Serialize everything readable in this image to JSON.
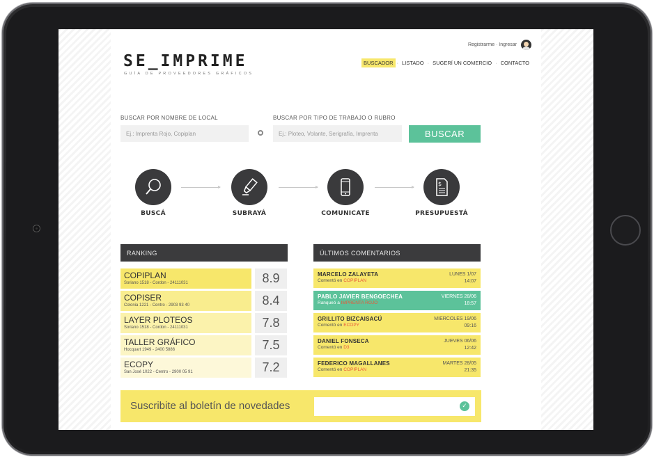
{
  "header": {
    "user_links": "Registrarme · Ingresar",
    "brand": "SE_IMPRIME",
    "tagline": "GUÍA DE PROVEEDORES GRÁFICOS",
    "nav": [
      {
        "label": "BUSCADOR",
        "active": true
      },
      {
        "label": "LISTADO",
        "active": false
      },
      {
        "label": "SUGERÍ UN COMERCIO",
        "active": false
      },
      {
        "label": "CONTACTO",
        "active": false
      }
    ],
    "nav_separator": "·"
  },
  "search": {
    "by_name_label": "BUSCAR POR NOMBRE DE LOCAL",
    "by_name_placeholder": "Ej.: Imprenta Rojo, Copiplan",
    "by_type_label": "BUSCAR POR TIPO DE TRABAJO O RUBRO",
    "by_type_placeholder": "Ej.: Ploteo, Volante, Serigrafía, Imprenta",
    "button_label": "BUSCAR"
  },
  "steps": [
    {
      "label": "BUSCÁ",
      "icon": "magnifier-icon"
    },
    {
      "label": "SUBRAYÁ",
      "icon": "highlighter-icon"
    },
    {
      "label": "COMUNICATE",
      "icon": "phone-icon"
    },
    {
      "label": "PRESUPUESTÁ",
      "icon": "invoice-icon"
    }
  ],
  "ranking": {
    "title": "RANKING",
    "items": [
      {
        "name": "COPIPLAN",
        "address": "Soriano 1518 - Cordon - 24111031",
        "score": "8.9",
        "color": "#f7e76b"
      },
      {
        "name": "COPISER",
        "address": "Colonia 1221 - Centro - 2903 93 40",
        "score": "8.4",
        "color": "#f9ed8e"
      },
      {
        "name": "LAYER PLOTEOS",
        "address": "Soriano 1518 - Cordon - 24111031",
        "score": "7.8",
        "color": "#fbf2ab"
      },
      {
        "name": "TALLER GRÁFICO",
        "address": "Hocquart 1949 - 2400 5886",
        "score": "7.5",
        "color": "#fcf5c4"
      },
      {
        "name": "ECOPY",
        "address": "San José 1022 - Centro - 2900 05 91",
        "score": "7.2",
        "color": "#fdf8d9"
      }
    ]
  },
  "comments": {
    "title": "ÚLTIMOS COMENTARIOS",
    "items": [
      {
        "author": "MARCELO ZALAYETA",
        "action": "Comentó en",
        "shop": "COPIPLAN",
        "day": "LUNES 1/07",
        "time": "14:07",
        "highlight": false
      },
      {
        "author": "PABLO JAVIER BENGOECHEA",
        "action": "Ranqueó a",
        "shop": "IMPRENTA ROJO",
        "day": "VIERNES 28/06",
        "time": "18:57",
        "highlight": true
      },
      {
        "author": "GRILLITO BIZCAISACÚ",
        "action": "Comentó en",
        "shop": "ECOPY",
        "day": "MIERCOLES 19/06",
        "time": "09:16",
        "highlight": false
      },
      {
        "author": "DANIEL FONSECA",
        "action": "Comentó en",
        "shop": "D3",
        "day": "JUEVES 06/06",
        "time": "12:42",
        "highlight": false
      },
      {
        "author": "FEDERICO MAGALLANES",
        "action": "Comentó en",
        "shop": "COPIPLAN",
        "day": "MARTES 28/05",
        "time": "21:35",
        "highlight": false
      }
    ]
  },
  "newsletter": {
    "text": "Suscribite al boletín de novedades",
    "placeholder": ""
  }
}
